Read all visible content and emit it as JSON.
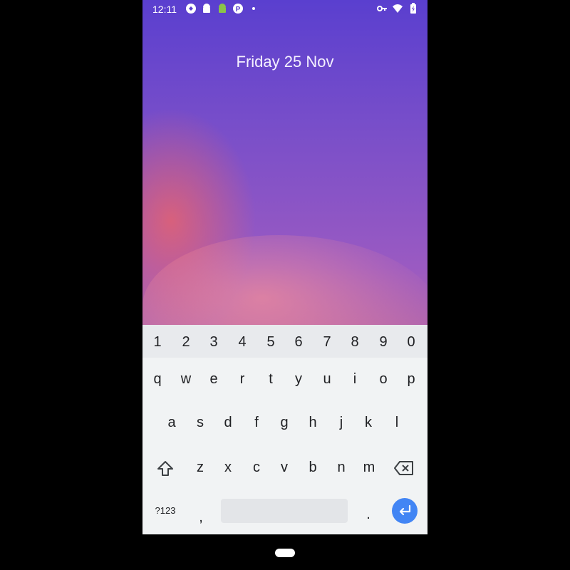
{
  "status": {
    "time": "12:11"
  },
  "lockscreen": {
    "date": "Friday 25 Nov"
  },
  "keyboard": {
    "numbers": [
      "1",
      "2",
      "3",
      "4",
      "5",
      "6",
      "7",
      "8",
      "9",
      "0"
    ],
    "row1": [
      "q",
      "w",
      "e",
      "r",
      "t",
      "y",
      "u",
      "i",
      "o",
      "p"
    ],
    "row2": [
      "a",
      "s",
      "d",
      "f",
      "g",
      "h",
      "j",
      "k",
      "l"
    ],
    "row3": [
      "z",
      "x",
      "c",
      "v",
      "b",
      "n",
      "m"
    ],
    "symbols_label": "?123",
    "comma": ",",
    "period": "."
  },
  "colors": {
    "enter": "#4285f4",
    "keyboard_bg": "#f1f3f4"
  }
}
